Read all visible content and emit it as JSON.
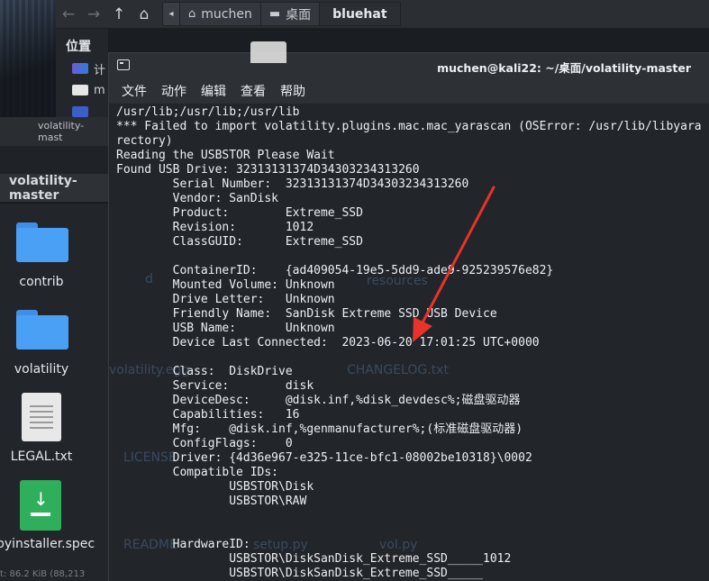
{
  "fm_toolbar": {
    "crumbs": [
      "muchen",
      "桌面",
      "bluehat"
    ]
  },
  "sidebar": {
    "title": "位置",
    "items": [
      "计",
      "m",
      ""
    ]
  },
  "folder_window": {
    "title": "volatility-mast",
    "tab": "volatility-master",
    "items": [
      "contrib",
      "volatility",
      "LEGAL.txt",
      "pyinstaller.spec"
    ],
    "status": "t: 86.2 KiB (88,213"
  },
  "ghost_labels": [
    "d",
    "resources",
    "volatility.egg",
    "CHANGELOG.txt",
    "LICENSE",
    "setup.py",
    "README",
    "vol.py"
  ],
  "terminal": {
    "title": "muchen@kali22: ~/桌面/volatility-master",
    "menu": [
      "文件",
      "动作",
      "编辑",
      "查看",
      "帮助"
    ],
    "lines": [
      "/usr/lib;/usr/lib;/usr/lib",
      "*** Failed to import volatility.plugins.mac.mac_yarascan (OSError: /usr/lib/libyara",
      "rectory)",
      "Reading the USBSTOR Please Wait",
      "Found USB Drive: 32313131374D34303234313260",
      "        Serial Number:  32313131374D34303234313260",
      "        Vendor: SanDisk",
      "        Product:        Extreme_SSD",
      "        Revision:       1012",
      "        ClassGUID:      Extreme_SSD",
      "",
      "        ContainerID:    {ad409054-19e5-5dd9-ade9-925239576e82}",
      "        Mounted Volume: Unknown",
      "        Drive Letter:   Unknown",
      "        Friendly Name:  SanDisk Extreme SSD USB Device",
      "        USB Name:       Unknown",
      "        Device Last Connected:  2023-06-20 17:01:25 UTC+0000",
      "",
      "        Class:  DiskDrive",
      "        Service:        disk",
      "        DeviceDesc:     @disk.inf,%disk_devdesc%;磁盘驱动器",
      "        Capabilities:   16",
      "        Mfg:    @disk.inf,%genmanufacturer%;(标准磁盘驱动器)",
      "        ConfigFlags:    0",
      "        Driver: {4d36e967-e325-11ce-bfc1-08002be10318}\\0002",
      "        Compatible IDs:",
      "                USBSTOR\\Disk",
      "                USBSTOR\\RAW",
      "",
      "",
      "        HardwareID:",
      "                USBSTOR\\DiskSanDisk_Extreme_SSD_____1012",
      "                USBSTOR\\DiskSanDisk_Extreme_SSD_____"
    ]
  },
  "colors": {
    "annotation_arrow": "#e8332a",
    "folder_blue": "#4aa0f5",
    "terminal_bg": "#22252a"
  }
}
